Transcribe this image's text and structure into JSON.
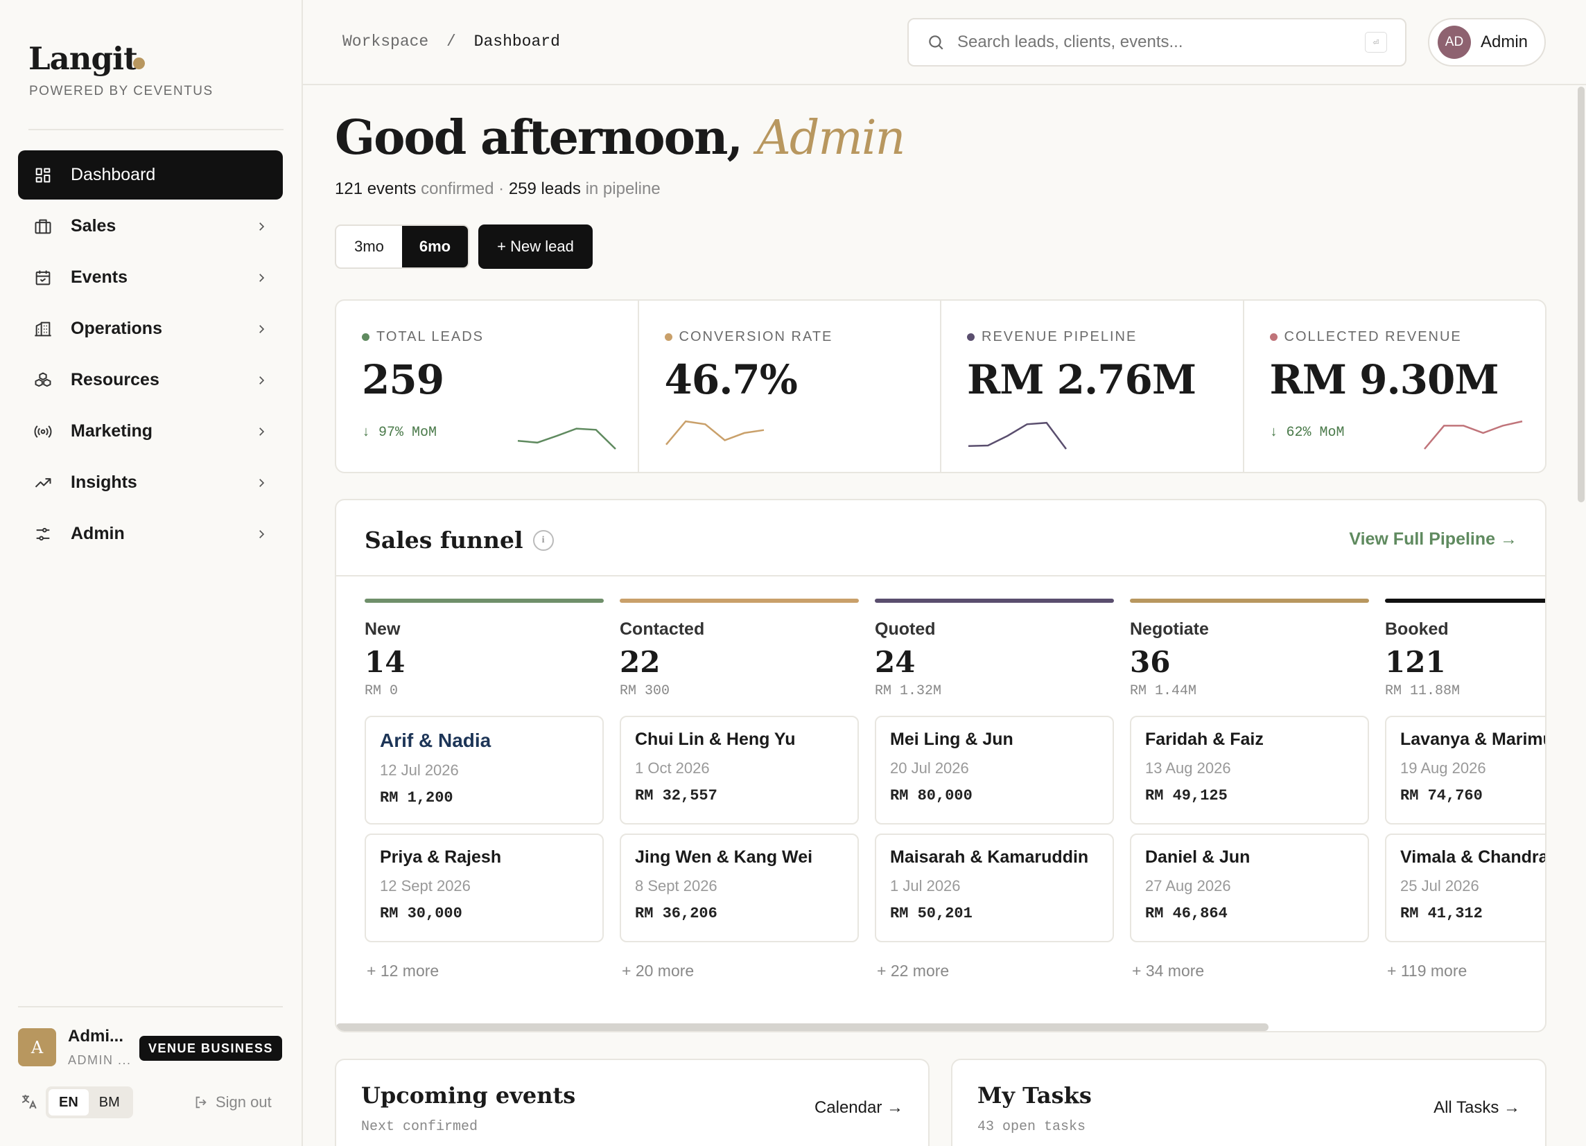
{
  "sidebar": {
    "logo": "Langit",
    "powered_by": "POWERED BY CEVENTUS",
    "nav": [
      {
        "label": "Dashboard",
        "icon": "grid-icon",
        "active": true
      },
      {
        "label": "Sales",
        "icon": "briefcase-icon"
      },
      {
        "label": "Events",
        "icon": "calendar-icon"
      },
      {
        "label": "Operations",
        "icon": "building-icon"
      },
      {
        "label": "Resources",
        "icon": "boxes-icon"
      },
      {
        "label": "Marketing",
        "icon": "broadcast-icon"
      },
      {
        "label": "Insights",
        "icon": "trend-up-icon"
      },
      {
        "label": "Admin",
        "icon": "sliders-icon"
      }
    ],
    "user": {
      "initial": "A",
      "name": "Admi...",
      "role": "ADMIN ...",
      "badge": "VENUE BUSINESS"
    },
    "lang": {
      "en": "EN",
      "bm": "BM",
      "selected": "EN"
    },
    "signout": "Sign out"
  },
  "header": {
    "crumb_root": "Workspace",
    "crumb_sep": "/",
    "crumb_current": "Dashboard",
    "search_placeholder": "Search leads, clients, events...",
    "search_kbd": "⏎",
    "admin_initials": "AD",
    "admin_label": "Admin"
  },
  "greeting": {
    "prefix": "Good afternoon,",
    "name": "Admin",
    "events_count": "121 events",
    "events_text": "confirmed ·",
    "leads_count": "259 leads",
    "leads_text": "in pipeline"
  },
  "controls": {
    "range_3": "3mo",
    "range_6": "6mo",
    "range_selected": "6mo",
    "new_lead": "+ New lead"
  },
  "kpis": [
    {
      "label": "TOTAL LEADS",
      "value": "259",
      "delta": "↓ 97% MoM",
      "color": "#5f8a5f",
      "spark": [
        0.28,
        0.22,
        0.45,
        0.7,
        0.66,
        0.0
      ]
    },
    {
      "label": "CONVERSION RATE",
      "value": "46.7%",
      "delta": "",
      "color": "#c9a06a",
      "spark": [
        0.15,
        0.95,
        0.85,
        0.3,
        0.55,
        0.65
      ]
    },
    {
      "label": "REVENUE PIPELINE",
      "value": "RM 2.76M",
      "delta": "",
      "color": "#5a4e6e",
      "spark": [
        0.1,
        0.12,
        0.45,
        0.85,
        0.9,
        0.0
      ]
    },
    {
      "label": "COLLECTED REVENUE",
      "value": "RM 9.30M",
      "delta": "↓ 62% MoM",
      "color": "#c0747a",
      "spark": [
        0.0,
        0.8,
        0.8,
        0.55,
        0.8,
        0.95
      ]
    }
  ],
  "funnel": {
    "title": "Sales funnel",
    "info": "i",
    "link": "View Full Pipeline →",
    "columns": [
      {
        "name": "New",
        "count": "14",
        "amount": "RM 0",
        "color": "#6f8f6a",
        "more": "+ 12 more",
        "cards": [
          {
            "name": "Arif & Nadia",
            "date": "12 Jul 2026",
            "amount": "RM 1,200"
          },
          {
            "name": "Priya & Rajesh",
            "date": "12 Sept 2026",
            "amount": "RM 30,000"
          }
        ]
      },
      {
        "name": "Contacted",
        "count": "22",
        "amount": "RM 300",
        "color": "#c9a06a",
        "more": "+ 20 more",
        "cards": [
          {
            "name": "Chui Lin & Heng Yu",
            "date": "1 Oct 2026",
            "amount": "RM 32,557"
          },
          {
            "name": "Jing Wen & Kang Wei",
            "date": "8 Sept 2026",
            "amount": "RM 36,206"
          }
        ]
      },
      {
        "name": "Quoted",
        "count": "24",
        "amount": "RM 1.32M",
        "color": "#5a4e6e",
        "more": "+ 22 more",
        "cards": [
          {
            "name": "Mei Ling & Jun",
            "date": "20 Jul 2026",
            "amount": "RM 80,000"
          },
          {
            "name": "Maisarah & Kamaruddin",
            "date": "1 Jul 2026",
            "amount": "RM 50,201"
          }
        ]
      },
      {
        "name": "Negotiate",
        "count": "36",
        "amount": "RM 1.44M",
        "color": "#b8975f",
        "more": "+ 34 more",
        "cards": [
          {
            "name": "Faridah & Faiz",
            "date": "13 Aug 2026",
            "amount": "RM 49,125"
          },
          {
            "name": "Daniel & Jun",
            "date": "27 Aug 2026",
            "amount": "RM 46,864"
          }
        ]
      },
      {
        "name": "Booked",
        "count": "121",
        "amount": "RM 11.88M",
        "color": "#111111",
        "more": "+ 119 more",
        "cards": [
          {
            "name": "Lavanya & Marimuthu",
            "date": "19 Aug 2026",
            "amount": "RM 74,760"
          },
          {
            "name": "Vimala & Chandran",
            "date": "25 Jul 2026",
            "amount": "RM 41,312"
          }
        ]
      }
    ]
  },
  "upcoming": {
    "title": "Upcoming events",
    "sub": "Next confirmed",
    "link": "Calendar →"
  },
  "tasks": {
    "title": "My Tasks",
    "sub": "43 open tasks",
    "link": "All Tasks →"
  }
}
